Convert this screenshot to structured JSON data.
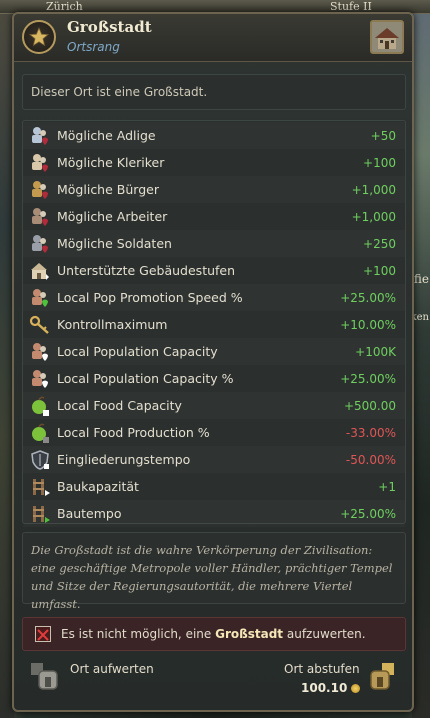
{
  "background": {
    "top_left_text": "Zürich",
    "top_right_text": "Stufe II",
    "right_text_1": "fie",
    "right_text_2": "ken"
  },
  "tooltip": {
    "title": "Großstadt",
    "subtitle": "Ortsrang",
    "description": "Dieser Ort ist eine Großstadt.",
    "modifiers": [
      {
        "label": "Mögliche Adlige",
        "value": "+50",
        "sign": "pos",
        "icon": "nobles-icon"
      },
      {
        "label": "Mögliche Kleriker",
        "value": "+100",
        "sign": "pos",
        "icon": "clergy-icon"
      },
      {
        "label": "Mögliche Bürger",
        "value": "+1,000",
        "sign": "pos",
        "icon": "burghers-icon"
      },
      {
        "label": "Mögliche Arbeiter",
        "value": "+1,000",
        "sign": "pos",
        "icon": "laborers-icon"
      },
      {
        "label": "Mögliche Soldaten",
        "value": "+250",
        "sign": "pos",
        "icon": "soldiers-icon"
      },
      {
        "label": "Unterstützte Gebäudestufen",
        "value": "+100",
        "sign": "pos",
        "icon": "building-levels-icon"
      },
      {
        "label": "Local Pop Promotion Speed %",
        "value": "+25.00%",
        "sign": "pos",
        "icon": "pop-promotion-icon"
      },
      {
        "label": "Kontrollmaximum",
        "value": "+10.00%",
        "sign": "pos",
        "icon": "key-icon"
      },
      {
        "label": "Local Population Capacity",
        "value": "+100K",
        "sign": "pos",
        "icon": "population-capacity-icon"
      },
      {
        "label": "Local Population Capacity %",
        "value": "+25.00%",
        "sign": "pos",
        "icon": "population-capacity-percent-icon"
      },
      {
        "label": "Local Food Capacity",
        "value": "+500.00",
        "sign": "pos",
        "icon": "food-capacity-icon"
      },
      {
        "label": "Local Food Production %",
        "value": "-33.00%",
        "sign": "neg",
        "icon": "food-production-icon"
      },
      {
        "label": "Eingliederungstempo",
        "value": "-50.00%",
        "sign": "neg",
        "icon": "integration-shield-icon"
      },
      {
        "label": "Baukapazität",
        "value": "+1",
        "sign": "pos",
        "icon": "build-capacity-icon"
      },
      {
        "label": "Bautempo",
        "value": "+25.00%",
        "sign": "pos",
        "icon": "build-speed-icon"
      }
    ],
    "flavor_text": "Die Großstadt ist die wahre Verkörperung der Zivilisation: eine geschäftige Metropole voller Händler, prächtiger Tempel und Sitze der Regierungsautorität, die mehrere Viertel umfasst.",
    "warning_prefix": "Es ist nicht möglich, eine ",
    "warning_bold": "Großstadt",
    "warning_suffix": " aufzuwerten.",
    "upgrade_label": "Ort aufwerten",
    "downgrade_label": "Ort abstufen",
    "downgrade_cost": "100.10"
  },
  "colors": {
    "positive": "#6fcf5e",
    "negative": "#e05555",
    "border_gold": "#b59a5e",
    "subtitle_blue": "#7fa8c8"
  }
}
